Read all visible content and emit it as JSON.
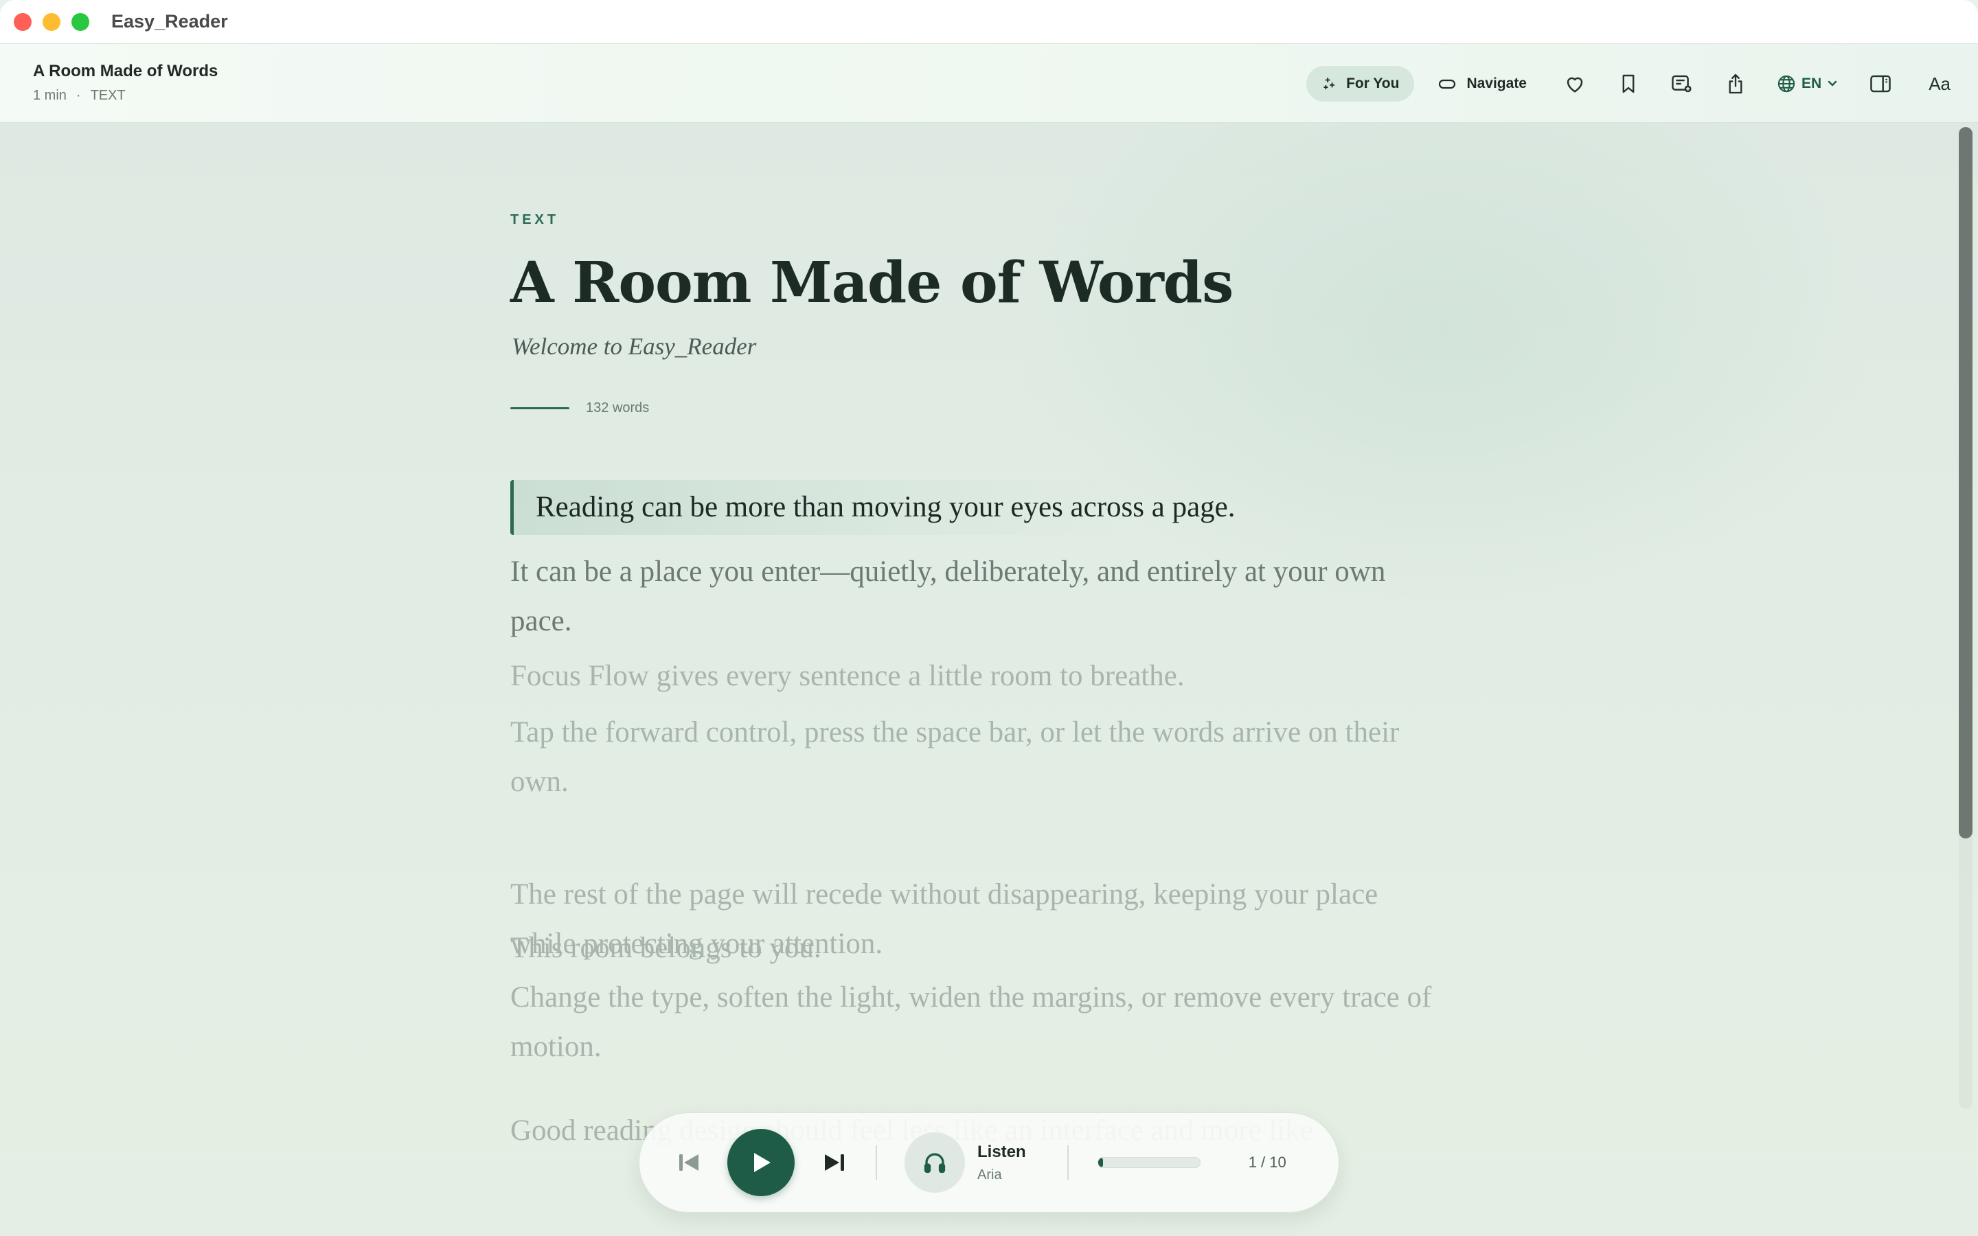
{
  "window": {
    "title": "Easy_Reader"
  },
  "toolbar": {
    "doc_title": "A Room Made of Words",
    "duration": "1 min",
    "separator": "·",
    "doc_type": "TEXT",
    "for_you_label": "For You",
    "navigate_label": "Navigate",
    "language": "EN",
    "font_label": "Aa"
  },
  "article": {
    "kicker": "TEXT",
    "title": "A Room Made of Words",
    "subtitle": "Welcome to Easy_Reader",
    "word_count": "132 words",
    "current_sentence": "Reading can be more than moving your eyes across a page.",
    "sentences": [
      "It can be a place you enter—quietly, deliberately, and entirely at your own pace.",
      "Focus Flow gives every sentence a little room to breathe.",
      "Tap the forward control, press the space bar, or let the words arrive on their own.",
      "The rest of the page will recede without disappearing, keeping your place while protecting your attention.",
      "This room belongs to you.",
      "Change the type, soften the light, widen the margins, or remove every trace of motion.",
      "Good reading design should feel less like an interface and more like"
    ]
  },
  "player": {
    "listen_title": "Listen",
    "voice": "Aria",
    "progress_fraction": 0.05,
    "counter": "1 / 10"
  },
  "colors": {
    "accent": "#1f5c47",
    "accent_soft": "#d6e8de",
    "background": "#e1ece4"
  }
}
